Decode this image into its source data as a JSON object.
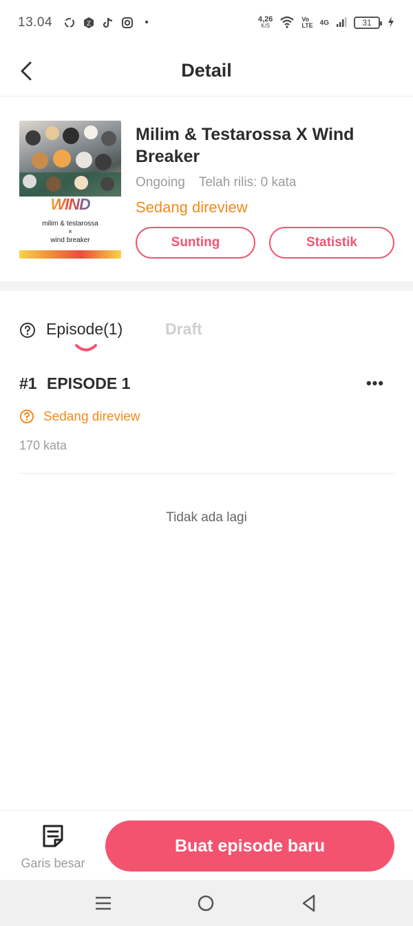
{
  "status_bar": {
    "time": "13.04",
    "dot": "•",
    "net_speed_value": "4,26",
    "net_speed_unit": "K/S",
    "volte_top": "Vo",
    "volte_bottom": "LTE",
    "network": "4G",
    "battery": "31",
    "icons": [
      "sync-icon",
      "app-icon",
      "tiktok-icon",
      "instagram-icon",
      "wifi-icon",
      "signal-icon",
      "charging-icon"
    ]
  },
  "header": {
    "title": "Detail",
    "back_icon": "chevron-left-icon"
  },
  "book": {
    "cover": {
      "logo_text": "WIND BREAKER",
      "line1": "milim & testarossa",
      "line2": "×",
      "line3": "wind breaker"
    },
    "title": "Milim & Testarossa X Wind Breaker",
    "state": "Ongoing",
    "released": "Telah rilis: 0 kata",
    "review_status": "Sedang direview",
    "edit_label": "Sunting",
    "stats_label": "Statistik"
  },
  "tabs": {
    "episode_label": "Episode(1)",
    "draft_label": "Draft",
    "active": "Episode(1)"
  },
  "episodes": [
    {
      "number": "#1",
      "title": "EPISODE 1",
      "status": "Sedang direview",
      "words": "170 kata",
      "more": "•••"
    }
  ],
  "list_end_text": "Tidak ada lagi",
  "bottom_bar": {
    "outline_label": "Garis besar",
    "primary_label": "Buat episode baru"
  },
  "colors": {
    "accent": "#f4536f",
    "outline_accent": "#ee5572",
    "review_orange": "#f28a1b",
    "muted_text": "#9b9b9b"
  }
}
